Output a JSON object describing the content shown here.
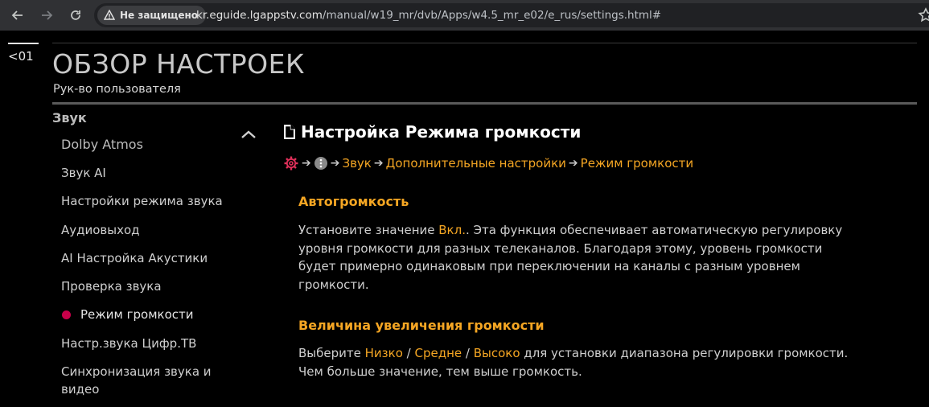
{
  "browser": {
    "security_label": "Не защищено",
    "url_host": "kr.eguide.lgappstv.com",
    "url_path": "/manual/w19_mr/dvb/Apps/w4.5_mr_e02/e_rus/settings.html#"
  },
  "header": {
    "back_label": "<01",
    "title": "ОБЗОР НАСТРОЕК",
    "subtitle": "Рук-во пользователя"
  },
  "sidebar": {
    "heading": "Звук",
    "items": [
      {
        "label": "Dolby Atmos"
      },
      {
        "label": "Звук AI"
      },
      {
        "label": "Настройки режима звука"
      },
      {
        "label": "Аудиовыход"
      },
      {
        "label": "AI Настройка Акустики"
      },
      {
        "label": "Проверка звука"
      },
      {
        "label": "Режим громкости",
        "active": true
      },
      {
        "label": "Настр.звука Цифр.ТВ"
      },
      {
        "label": "Синхронизация звука и"
      },
      {
        "label": "видео"
      }
    ]
  },
  "main": {
    "title": "Настройка Режима громкости",
    "breadcrumb": {
      "items": [
        "Звук",
        "Дополнительные настройки",
        "Режим громкости"
      ]
    },
    "sections": [
      {
        "heading": "Автогромкость",
        "text_pre": "Установите значение ",
        "text_hl": "Вкл.",
        "text_line1": ". Эта функция обеспечивает автоматическую регулировку",
        "line2": "уровня громкости для разных телеканалов. Благодаря этому, уровень громкости",
        "line3": "будет примерно одинаковым при переключении на каналы с разным уровнем",
        "line4": "громкости."
      },
      {
        "heading": "Величина увеличения громкости",
        "text_pre": "Выберите ",
        "opt1": "Низко",
        "sep": " / ",
        "opt2": "Средне",
        "opt3": "Высоко",
        "text_post": " для установки диапазона регулировки громкости.",
        "line2": "Чем больше значение, тем выше громкость."
      }
    ]
  },
  "colors": {
    "accent": "#f5a623",
    "active_dot": "#c8004a",
    "background": "#000000"
  }
}
